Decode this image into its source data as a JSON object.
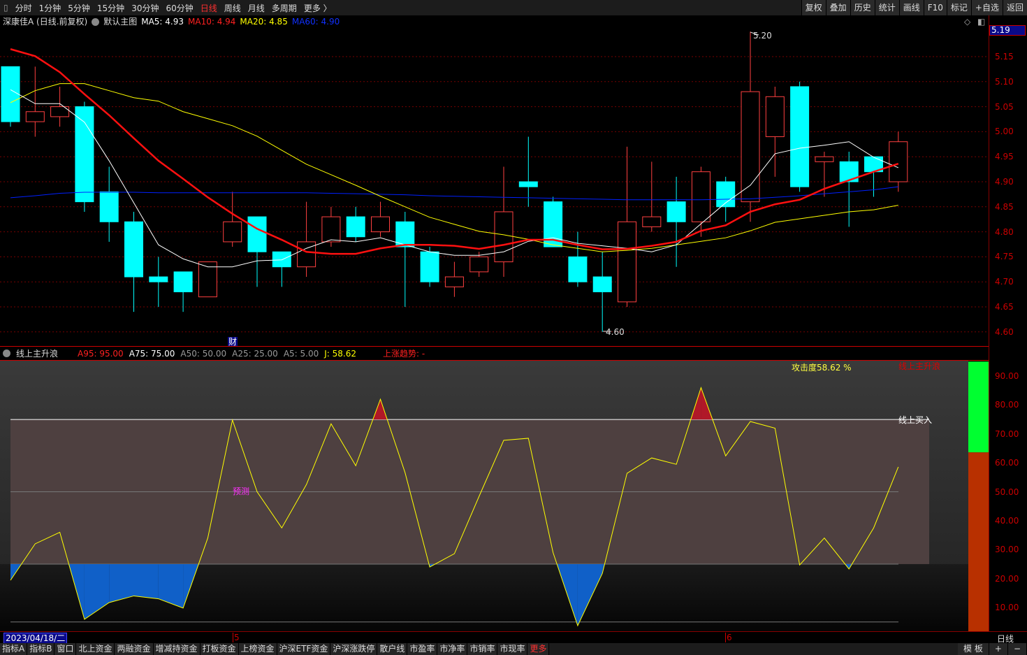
{
  "topbar": {
    "items": [
      "分时",
      "1分钟",
      "5分钟",
      "15分钟",
      "30分钟",
      "60分钟",
      "日线",
      "周线",
      "月线",
      "多周期",
      "更多 〉"
    ],
    "active": "日线",
    "right": [
      "复权",
      "叠加",
      "历史",
      "统计",
      "画线",
      "F10",
      "标记",
      "+自选",
      "返回"
    ]
  },
  "info": {
    "title": "深康佳A (日线.前复权)",
    "layout": "默认主图",
    "ma5": "MA5: 4.93",
    "ma10": "MA10: 4.94",
    "ma20": "MA20: 4.85",
    "ma60": "MA60: 4.90"
  },
  "colors": {
    "up": "#ff4040",
    "down": "#00ffff",
    "ma5": "#ffffff",
    "ma10": "#ff1010",
    "ma20": "#ffff00",
    "ma60": "#0020ff",
    "axis": "#b00000"
  },
  "price_axis": {
    "ticks": [
      "5.15",
      "5.10",
      "5.05",
      "5.00",
      "4.95",
      "4.90",
      "4.85",
      "4.80",
      "4.75",
      "4.70",
      "4.65",
      "4.60"
    ],
    "current": "5.19"
  },
  "markers": {
    "high": "5.20",
    "low": "4.60",
    "fin": "财"
  },
  "chart_data": {
    "type": "candlestick",
    "candles": [
      [
        5.13,
        5.02,
        5.13,
        5.01
      ],
      [
        5.02,
        5.04,
        5.13,
        4.99
      ],
      [
        5.03,
        5.05,
        5.09,
        5.01
      ],
      [
        5.05,
        4.86,
        5.06,
        4.84
      ],
      [
        4.88,
        4.82,
        4.93,
        4.78
      ],
      [
        4.82,
        4.71,
        4.84,
        4.64
      ],
      [
        4.71,
        4.7,
        4.75,
        4.65
      ],
      [
        4.72,
        4.68,
        4.72,
        4.64
      ],
      [
        4.67,
        4.74,
        4.74,
        4.67
      ],
      [
        4.78,
        4.82,
        4.88,
        4.77
      ],
      [
        4.83,
        4.76,
        4.83,
        4.69
      ],
      [
        4.76,
        4.73,
        4.76,
        4.69
      ],
      [
        4.73,
        4.78,
        4.86,
        4.71
      ],
      [
        4.78,
        4.83,
        4.85,
        4.77
      ],
      [
        4.83,
        4.79,
        4.85,
        4.78
      ],
      [
        4.8,
        4.83,
        4.86,
        4.79
      ],
      [
        4.82,
        4.77,
        4.84,
        4.65
      ],
      [
        4.76,
        4.7,
        4.77,
        4.69
      ],
      [
        4.69,
        4.71,
        4.74,
        4.67
      ],
      [
        4.72,
        4.75,
        4.76,
        4.71
      ],
      [
        4.74,
        4.84,
        4.93,
        4.71
      ],
      [
        4.9,
        4.89,
        4.99,
        4.85
      ],
      [
        4.86,
        4.77,
        4.87,
        4.77
      ],
      [
        4.75,
        4.7,
        4.8,
        4.69
      ],
      [
        4.71,
        4.68,
        4.76,
        4.6
      ],
      [
        4.66,
        4.82,
        4.97,
        4.65
      ],
      [
        4.81,
        4.83,
        4.94,
        4.8
      ],
      [
        4.86,
        4.82,
        4.91,
        4.73
      ],
      [
        4.82,
        4.92,
        4.93,
        4.79
      ],
      [
        4.9,
        4.85,
        4.91,
        4.82
      ],
      [
        4.86,
        5.08,
        5.2,
        4.82
      ],
      [
        4.99,
        5.07,
        5.09,
        4.91
      ],
      [
        5.09,
        4.89,
        5.1,
        4.88
      ],
      [
        4.94,
        4.95,
        4.96,
        4.87
      ],
      [
        4.94,
        4.9,
        4.96,
        4.81
      ],
      [
        4.95,
        4.92,
        4.95,
        4.87
      ],
      [
        4.9,
        4.98,
        5.0,
        4.88
      ]
    ],
    "ma5": [
      5.084,
      5.056,
      5.056,
      5.019,
      4.942,
      4.858,
      4.774,
      4.746,
      4.73,
      4.73,
      4.742,
      4.744,
      4.767,
      4.784,
      4.78,
      4.788,
      4.774,
      4.76,
      4.753,
      4.753,
      4.76,
      4.781,
      4.788,
      4.777,
      4.772,
      4.767,
      4.76,
      4.774,
      4.816,
      4.858,
      4.893,
      4.956,
      4.967,
      4.973,
      4.98,
      4.949,
      4.928
    ],
    "ma10": [
      5.165,
      5.151,
      5.119,
      5.075,
      5.033,
      4.987,
      4.942,
      4.906,
      4.869,
      4.836,
      4.806,
      4.784,
      4.76,
      4.756,
      4.756,
      4.767,
      4.774,
      4.774,
      4.772,
      4.766,
      4.774,
      4.784,
      4.784,
      4.774,
      4.765,
      4.766,
      4.772,
      4.78,
      4.802,
      4.813,
      4.84,
      4.855,
      4.864,
      4.886,
      4.903,
      4.92,
      4.936
    ],
    "ma20": [
      5.058,
      5.082,
      5.096,
      5.096,
      5.082,
      5.068,
      5.061,
      5.04,
      5.026,
      5.012,
      4.991,
      4.963,
      4.935,
      4.914,
      4.893,
      4.871,
      4.85,
      4.829,
      4.815,
      4.801,
      4.794,
      4.785,
      4.774,
      4.767,
      4.76,
      4.763,
      4.767,
      4.774,
      4.781,
      4.788,
      4.802,
      4.819,
      4.826,
      4.833,
      4.84,
      4.844,
      4.853
    ],
    "ma60": [
      4.868,
      4.872,
      4.877,
      4.879,
      4.879,
      4.879,
      4.878,
      4.878,
      4.878,
      4.878,
      4.878,
      4.878,
      4.878,
      4.877,
      4.876,
      4.875,
      4.874,
      4.872,
      4.871,
      4.87,
      4.869,
      4.868,
      4.867,
      4.866,
      4.865,
      4.864,
      4.864,
      4.864,
      4.864,
      4.865,
      4.866,
      4.869,
      4.872,
      4.876,
      4.88,
      4.884,
      4.89
    ],
    "ylim": [
      4.58,
      5.22
    ],
    "oscillator": {
      "name": "J",
      "values": [
        19.4,
        32,
        36,
        5.9,
        11.7,
        14,
        13,
        9.8,
        34,
        74.8,
        50,
        37.5,
        52.5,
        73.5,
        59,
        82,
        56.6,
        24,
        28.6,
        48.4,
        67.8,
        68.5,
        29,
        3.7,
        21.8,
        56.4,
        61.7,
        59.5,
        86,
        62.4,
        74.3,
        72,
        24.7,
        34,
        23.3,
        37.5,
        58.6
      ],
      "levels": [
        95,
        75,
        50,
        25,
        5
      ],
      "ylim": [
        0,
        100
      ],
      "ticks": [
        "90.00",
        "80.00",
        "70.00",
        "60.00",
        "50.00",
        "40.00",
        "30.00",
        "20.00",
        "10.00"
      ],
      "bar_value": 58.62
    }
  },
  "indicator": {
    "name": "线上主升浪",
    "a95": "A95: 95.00",
    "a75": "A75: 75.00",
    "a50": "A50: 50.00",
    "a25": "A25: 25.00",
    "a5": "A5: 5.00",
    "j": "J: 58.62",
    "trend": "上涨趋势: -",
    "attack": "攻击度58.62 %",
    "buy": "线上买入",
    "forecast": "预测",
    "title_clipped": "线上主升浪"
  },
  "datebar": {
    "date": "2023/04/18/二",
    "m5": "5",
    "m6": "6",
    "period": "日线"
  },
  "bottom": {
    "items": [
      "指标A",
      "指标B",
      "窗口",
      "北上资金",
      "两融资金",
      "增减持资金",
      "打板资金",
      "上榜资金",
      "沪深ETF资金",
      "沪深涨跌停",
      "散户线",
      "市盈率",
      "市净率",
      "市销率",
      "市现率",
      "更多"
    ],
    "right": [
      "模 板",
      "+",
      "−"
    ]
  }
}
